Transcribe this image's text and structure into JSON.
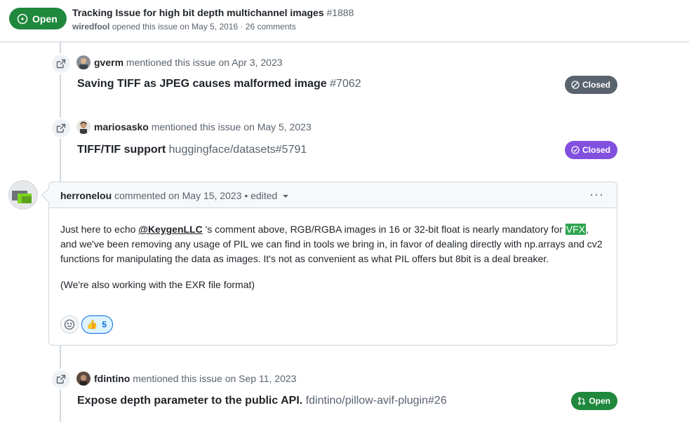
{
  "header": {
    "state": "Open",
    "title": "Tracking Issue for high bit depth multichannel images",
    "number": "#1888",
    "author": "wiredfool",
    "meta": "opened this issue on May 5, 2016 · 26 comments"
  },
  "timeline": {
    "events": [
      {
        "user": "gverm",
        "action": "mentioned this issue on Apr 3, 2023",
        "ref_title": "Saving TIFF as JPEG causes malformed image",
        "ref_num": "#7062",
        "status": "Closed",
        "status_color": "#59636e"
      },
      {
        "user": "mariosasko",
        "action": "mentioned this issue on May 5, 2023",
        "ref_title": "TIFF/TIF support",
        "ref_num": "huggingface/datasets#5791",
        "status": "Closed",
        "status_color": "#8250df"
      },
      {
        "user": "fdintino",
        "action": "mentioned this issue on Sep 11, 2023",
        "ref_title": "Expose depth parameter to the public API.",
        "ref_num": "fdintino/pillow-avif-plugin#26",
        "status": "Open",
        "status_color": "#1f883d"
      }
    ],
    "comment": {
      "author": "herronelou",
      "meta": "commented on May 15, 2023 • edited",
      "more_icon": "kebab-horizontal-icon",
      "p1_a": "Just here to echo ",
      "mention": "@KeygenLLC",
      "p1_b": " 's comment above, RGB/RGBA images in 16 or 32-bit float is nearly mandatory for ",
      "highlight": "VFX",
      "p1_c": ", and we've been removing any usage of PIL we can find in tools we bring in, in favor of dealing directly with np.arrays and cv2 functions for manipulating the data as images. It's not as convenient as what PIL offers but 8bit is a deal breaker.",
      "p2": "(We're also working with the EXR file format)",
      "reaction_emoji": "👍",
      "reaction_count": "5"
    }
  },
  "colors": {
    "open_green": "#1f883d",
    "closed_gray": "#59636e",
    "closed_purple": "#8250df",
    "link_blue": "#0969da",
    "border": "#d0d7de"
  }
}
